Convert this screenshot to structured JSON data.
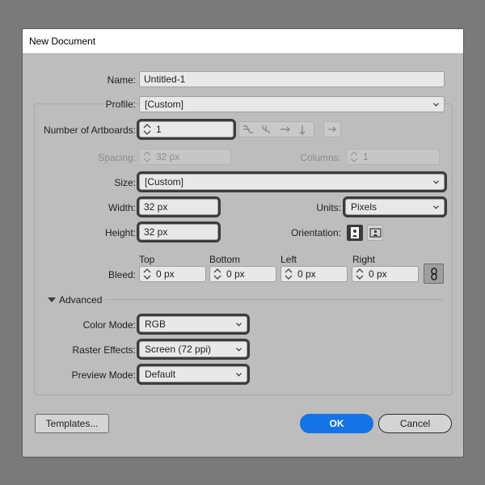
{
  "dialog": {
    "title": "New Document"
  },
  "name": {
    "label": "Name:",
    "value": "Untitled-1"
  },
  "profile": {
    "label": "Profile:",
    "value": "[Custom]"
  },
  "artboards": {
    "label": "Number of Artboards:",
    "value": "1"
  },
  "spacing": {
    "label": "Spacing:",
    "value": "32 px"
  },
  "columns": {
    "label": "Columns:",
    "value": "1"
  },
  "size": {
    "label": "Size:",
    "value": "[Custom]"
  },
  "width": {
    "label": "Width:",
    "value": "32 px"
  },
  "units": {
    "label": "Units:",
    "value": "Pixels"
  },
  "height": {
    "label": "Height:",
    "value": "32 px"
  },
  "orientation": {
    "label": "Orientation:"
  },
  "bleed": {
    "label": "Bleed:",
    "top": {
      "label": "Top",
      "value": "0 px"
    },
    "bottom": {
      "label": "Bottom",
      "value": "0 px"
    },
    "left": {
      "label": "Left",
      "value": "0 px"
    },
    "right": {
      "label": "Right",
      "value": "0 px"
    }
  },
  "advanced": {
    "label": "Advanced"
  },
  "color_mode": {
    "label": "Color Mode:",
    "value": "RGB"
  },
  "raster_effects": {
    "label": "Raster Effects:",
    "value": "Screen (72 ppi)"
  },
  "preview_mode": {
    "label": "Preview Mode:",
    "value": "Default"
  },
  "buttons": {
    "templates": "Templates...",
    "ok": "OK",
    "cancel": "Cancel"
  },
  "colors": {
    "accent": "#1473e6",
    "highlight_outline": "#3c3c3c",
    "dialog_bg": "#bdbdbd"
  }
}
